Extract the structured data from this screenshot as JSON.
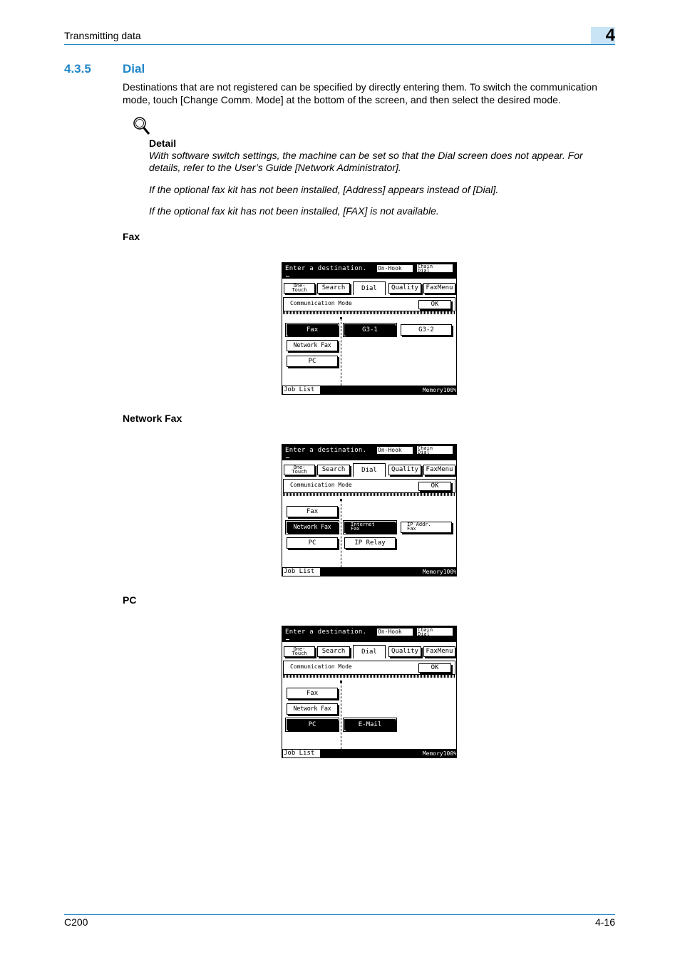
{
  "header": {
    "section": "Transmitting data",
    "chapter": "4"
  },
  "section": {
    "number": "4.3.5",
    "title": "Dial"
  },
  "intro": "Destinations that are not registered can be specified by directly entering them. To switch the communication mode, touch [Change Comm. Mode] at the bottom of the screen, and then select the desired mode.",
  "detail": {
    "icon": "magnifier-icon",
    "title": "Detail",
    "notes": [
      "With software switch settings, the machine can be set so that the Dial screen does not appear. For details, refer to the User’s Guide [Network Administrator].",
      "If the optional fax kit has not been installed, [Address] appears instead of [Dial].",
      "If the optional fax kit has not been installed, [FAX] is not available."
    ]
  },
  "screens": [
    {
      "heading": "Fax",
      "title": "Enter a destination.",
      "onhook": "On-Hook",
      "chain_dial": [
        "Chain",
        "Dial"
      ],
      "tabs": {
        "one_touch": [
          "One-",
          "Touch"
        ],
        "search": "Search",
        "dial": "Dial",
        "quality": "Quality",
        "faxmenu": "FaxMenu"
      },
      "comm_mode": "Communication Mode",
      "ok": "OK",
      "modes": [
        "Fax",
        "Network Fax",
        "PC"
      ],
      "selected_mode": "Fax",
      "options": [
        "G3-1",
        "G3-2"
      ],
      "selected_option": "G3-1",
      "job_list": "Job List",
      "memory": "Memory100%"
    },
    {
      "heading": "Network Fax",
      "title": "Enter a destination.",
      "onhook": "On-Hook",
      "chain_dial": [
        "Chain",
        "Dial"
      ],
      "tabs": {
        "one_touch": [
          "One-",
          "Touch"
        ],
        "search": "Search",
        "dial": "Dial",
        "quality": "Quality",
        "faxmenu": "FaxMenu"
      },
      "comm_mode": "Communication Mode",
      "ok": "OK",
      "modes": [
        "Fax",
        "Network Fax",
        "PC"
      ],
      "selected_mode": "Network Fax",
      "options": [
        [
          "Internet",
          "Fax"
        ],
        [
          "IP Addr.",
          "Fax"
        ],
        "IP Relay"
      ],
      "selected_option": "Internet Fax",
      "job_list": "Job List",
      "memory": "Memory100%"
    },
    {
      "heading": "PC",
      "title": "Enter a destination.",
      "onhook": "On-Hook",
      "chain_dial": [
        "Chain",
        "Dial"
      ],
      "tabs": {
        "one_touch": [
          "One-",
          "Touch"
        ],
        "search": "Search",
        "dial": "Dial",
        "quality": "Quality",
        "faxmenu": "FaxMenu"
      },
      "comm_mode": "Communication Mode",
      "ok": "OK",
      "modes": [
        "Fax",
        "Network Fax",
        "PC"
      ],
      "selected_mode": "PC",
      "options": [
        "E-Mail"
      ],
      "selected_option": "E-Mail",
      "job_list": "Job List",
      "memory": "Memory100%"
    }
  ],
  "footer": {
    "model": "C200",
    "page": "4-16"
  }
}
